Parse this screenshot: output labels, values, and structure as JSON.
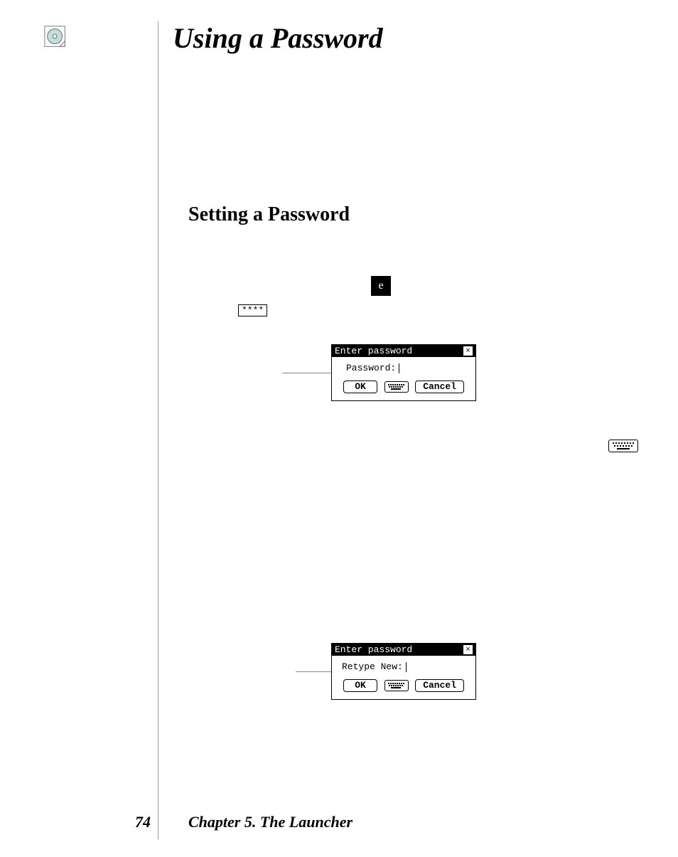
{
  "page_title": "Using a Password",
  "section_heading": "Setting a Password",
  "stars_label": "****",
  "dialog1": {
    "title": "Enter password",
    "field_label": "Password:",
    "ok": "OK",
    "cancel": "Cancel"
  },
  "dialog2": {
    "title": "Enter password",
    "field_label": "Retype New:",
    "ok": "OK",
    "cancel": "Cancel"
  },
  "footer": {
    "page_number": "74",
    "chapter": "Chapter 5. The Launcher"
  }
}
